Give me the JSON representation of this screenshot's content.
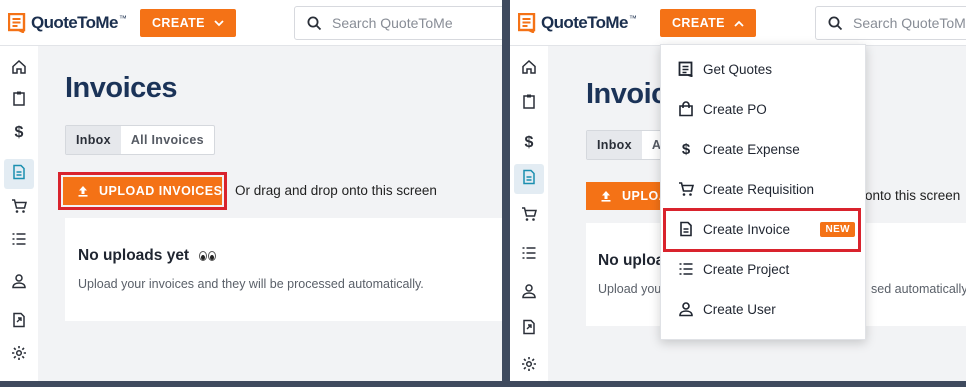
{
  "app": {
    "name": "QuoteToMe",
    "trademark": "™"
  },
  "header": {
    "create_label": "CREATE",
    "search_left_placeholder": "Search QuoteToMe",
    "search_right_placeholder": "Search QuoteToMe"
  },
  "sidebar": {
    "items": [
      {
        "icon": "home-icon"
      },
      {
        "icon": "clipboard-icon"
      },
      {
        "icon": "dollar-icon"
      },
      {
        "icon": "invoice-icon",
        "active": true
      },
      {
        "icon": "cart-icon"
      },
      {
        "icon": "list-icon"
      },
      {
        "icon": "user-icon"
      },
      {
        "icon": "import-icon"
      },
      {
        "icon": "gear-icon"
      }
    ]
  },
  "page": {
    "title": "Invoices",
    "title_clipped": "Invoic",
    "tabs": [
      "Inbox",
      "All Invoices"
    ],
    "tab_clipped": "A",
    "upload_label": "UPLOAD INVOICES",
    "upload_label_clipped": "UPLOA",
    "drag_text": "Or drag and drop onto this screen",
    "drag_text_clipped": "onto this screen",
    "empty_title": "No uploads yet",
    "empty_title_clipped": "No uploa",
    "empty_subtitle": "Upload your invoices and they will be processed automatically.",
    "empty_subtitle_clipped_left": "Upload you",
    "empty_subtitle_clipped_right": "sed automatically"
  },
  "create_menu": {
    "items": [
      {
        "label": "Get Quotes",
        "icon": "quote-icon"
      },
      {
        "label": "Create PO",
        "icon": "bag-icon"
      },
      {
        "label": "Create Expense",
        "icon": "dollar-icon"
      },
      {
        "label": "Create Requisition",
        "icon": "cart-icon"
      },
      {
        "label": "Create Invoice",
        "icon": "invoice-icon",
        "badge": "NEW",
        "highlighted": true
      },
      {
        "label": "Create Project",
        "icon": "list-icon"
      },
      {
        "label": "Create User",
        "icon": "user-icon"
      }
    ]
  },
  "colors": {
    "accent": "#f47216",
    "highlight": "#d9232d",
    "title": "#1b3358",
    "background": "#f2f3f5",
    "divider": "#3f4a5e"
  }
}
